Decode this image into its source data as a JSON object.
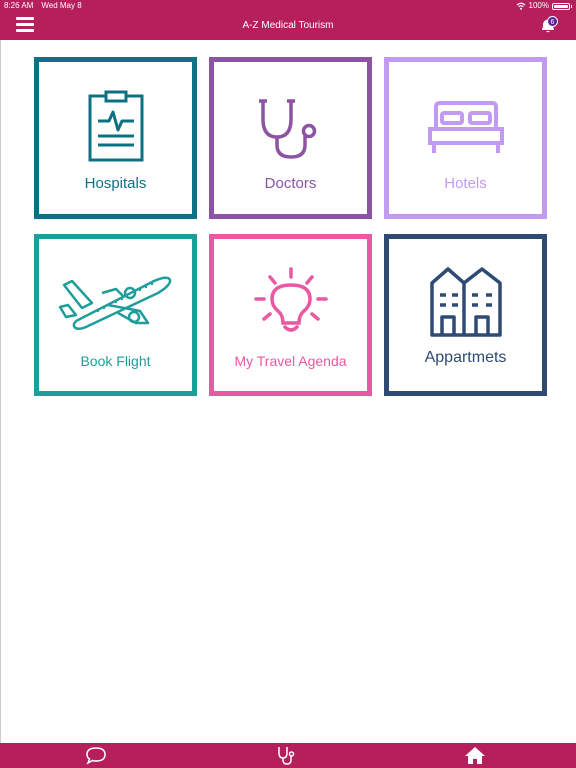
{
  "status_bar": {
    "time": "8:26 AM",
    "date": "Wed May 8",
    "battery": "100%"
  },
  "header": {
    "title": "A-Z Medical Tourism",
    "notification_count": "6"
  },
  "tiles": [
    {
      "label": "Hospitals",
      "icon": "clipboard-heartbeat-icon",
      "color": "#0e7183"
    },
    {
      "label": "Doctors",
      "icon": "stethoscope-icon",
      "color": "#8d54a3"
    },
    {
      "label": "Hotels",
      "icon": "bed-icon",
      "color": "#c39af2"
    },
    {
      "label": "Book Flight",
      "icon": "airplane-icon",
      "color": "#1e9e9a"
    },
    {
      "label": "My Travel Agenda",
      "icon": "lightbulb-icon",
      "color": "#ea57a2"
    },
    {
      "label": "Appartmets",
      "icon": "buildings-icon",
      "color": "#2f4a73"
    }
  ],
  "bottom_nav": [
    {
      "icon": "chat-bubble-icon"
    },
    {
      "icon": "stethoscope-icon"
    },
    {
      "icon": "home-icon"
    }
  ],
  "colors": {
    "brand": "#b5205c",
    "badge": "#5b1f9c"
  }
}
